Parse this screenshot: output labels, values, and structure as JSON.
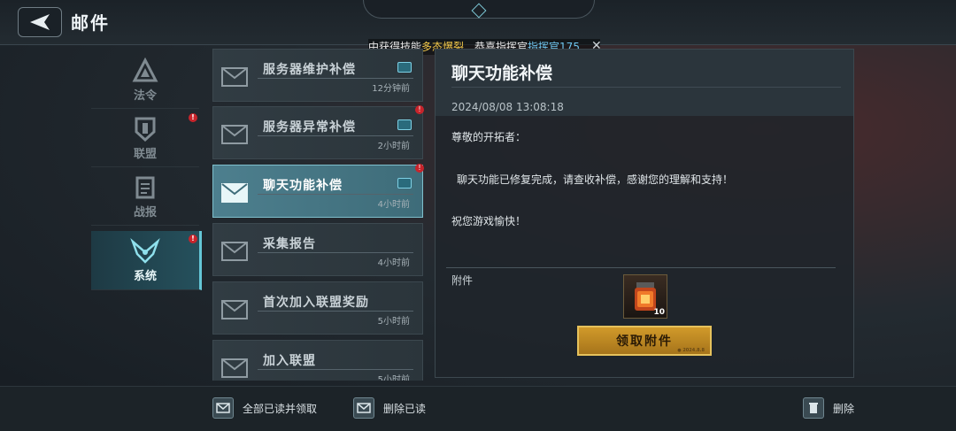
{
  "header": {
    "title": "邮件"
  },
  "ticker": {
    "prefix": "中获得技能",
    "skill": "多态爆裂",
    "mid": "　恭喜指挥官",
    "name": "指挥官175",
    "close_glyph": "✕"
  },
  "nav": {
    "items": [
      {
        "label": "法令",
        "badge": ""
      },
      {
        "label": "联盟",
        "badge": "!"
      },
      {
        "label": "战报",
        "badge": ""
      },
      {
        "label": "系统",
        "badge": "!"
      }
    ],
    "active_index": 3
  },
  "mails": [
    {
      "title": "服务器维护补偿",
      "time": "12分钟前",
      "has_gift": true,
      "badge": ""
    },
    {
      "title": "服务器异常补偿",
      "time": "2小时前",
      "has_gift": true,
      "badge": "!"
    },
    {
      "title": "聊天功能补偿",
      "time": "4小时前",
      "has_gift": true,
      "badge": "!"
    },
    {
      "title": "采集报告",
      "time": "4小时前",
      "has_gift": false,
      "badge": ""
    },
    {
      "title": "首次加入联盟奖励",
      "time": "5小时前",
      "has_gift": false,
      "badge": ""
    },
    {
      "title": "加入联盟",
      "time": "5小时前",
      "has_gift": false,
      "badge": ""
    }
  ],
  "selected_mail_index": 2,
  "detail": {
    "title": "聊天功能补偿",
    "date": "2024/08/08  13:08:18",
    "greeting": "尊敬的开拓者：",
    "body": "聊天功能已修复完成，请查收补偿，感谢您的理解和支持！",
    "closing": "祝您游戏愉快！",
    "attachment_label": "附件",
    "attachment_count": "10",
    "claim_label": "领取附件",
    "claim_ver": "● 2024.8.8"
  },
  "bottom": {
    "read_all": "全部已读并领取",
    "delete_read": "删除已读",
    "delete": "删除"
  },
  "colors": {
    "accent": "#64c6d6",
    "badge": "#c8242b",
    "claim": "#d19a2a"
  }
}
